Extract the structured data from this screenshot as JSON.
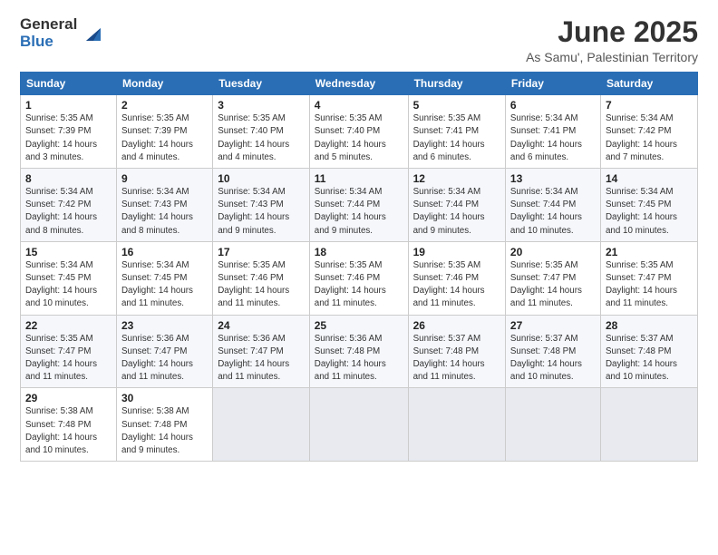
{
  "logo": {
    "general": "General",
    "blue": "Blue"
  },
  "title": "June 2025",
  "subtitle": "As Samu', Palestinian Territory",
  "days_of_week": [
    "Sunday",
    "Monday",
    "Tuesday",
    "Wednesday",
    "Thursday",
    "Friday",
    "Saturday"
  ],
  "weeks": [
    [
      {
        "day": "1",
        "sunrise": "5:35 AM",
        "sunset": "7:39 PM",
        "daylight": "14 hours and 3 minutes."
      },
      {
        "day": "2",
        "sunrise": "5:35 AM",
        "sunset": "7:39 PM",
        "daylight": "14 hours and 4 minutes."
      },
      {
        "day": "3",
        "sunrise": "5:35 AM",
        "sunset": "7:40 PM",
        "daylight": "14 hours and 4 minutes."
      },
      {
        "day": "4",
        "sunrise": "5:35 AM",
        "sunset": "7:40 PM",
        "daylight": "14 hours and 5 minutes."
      },
      {
        "day": "5",
        "sunrise": "5:35 AM",
        "sunset": "7:41 PM",
        "daylight": "14 hours and 6 minutes."
      },
      {
        "day": "6",
        "sunrise": "5:34 AM",
        "sunset": "7:41 PM",
        "daylight": "14 hours and 6 minutes."
      },
      {
        "day": "7",
        "sunrise": "5:34 AM",
        "sunset": "7:42 PM",
        "daylight": "14 hours and 7 minutes."
      }
    ],
    [
      {
        "day": "8",
        "sunrise": "5:34 AM",
        "sunset": "7:42 PM",
        "daylight": "14 hours and 8 minutes."
      },
      {
        "day": "9",
        "sunrise": "5:34 AM",
        "sunset": "7:43 PM",
        "daylight": "14 hours and 8 minutes."
      },
      {
        "day": "10",
        "sunrise": "5:34 AM",
        "sunset": "7:43 PM",
        "daylight": "14 hours and 9 minutes."
      },
      {
        "day": "11",
        "sunrise": "5:34 AM",
        "sunset": "7:44 PM",
        "daylight": "14 hours and 9 minutes."
      },
      {
        "day": "12",
        "sunrise": "5:34 AM",
        "sunset": "7:44 PM",
        "daylight": "14 hours and 9 minutes."
      },
      {
        "day": "13",
        "sunrise": "5:34 AM",
        "sunset": "7:44 PM",
        "daylight": "14 hours and 10 minutes."
      },
      {
        "day": "14",
        "sunrise": "5:34 AM",
        "sunset": "7:45 PM",
        "daylight": "14 hours and 10 minutes."
      }
    ],
    [
      {
        "day": "15",
        "sunrise": "5:34 AM",
        "sunset": "7:45 PM",
        "daylight": "14 hours and 10 minutes."
      },
      {
        "day": "16",
        "sunrise": "5:34 AM",
        "sunset": "7:45 PM",
        "daylight": "14 hours and 11 minutes."
      },
      {
        "day": "17",
        "sunrise": "5:35 AM",
        "sunset": "7:46 PM",
        "daylight": "14 hours and 11 minutes."
      },
      {
        "day": "18",
        "sunrise": "5:35 AM",
        "sunset": "7:46 PM",
        "daylight": "14 hours and 11 minutes."
      },
      {
        "day": "19",
        "sunrise": "5:35 AM",
        "sunset": "7:46 PM",
        "daylight": "14 hours and 11 minutes."
      },
      {
        "day": "20",
        "sunrise": "5:35 AM",
        "sunset": "7:47 PM",
        "daylight": "14 hours and 11 minutes."
      },
      {
        "day": "21",
        "sunrise": "5:35 AM",
        "sunset": "7:47 PM",
        "daylight": "14 hours and 11 minutes."
      }
    ],
    [
      {
        "day": "22",
        "sunrise": "5:35 AM",
        "sunset": "7:47 PM",
        "daylight": "14 hours and 11 minutes."
      },
      {
        "day": "23",
        "sunrise": "5:36 AM",
        "sunset": "7:47 PM",
        "daylight": "14 hours and 11 minutes."
      },
      {
        "day": "24",
        "sunrise": "5:36 AM",
        "sunset": "7:47 PM",
        "daylight": "14 hours and 11 minutes."
      },
      {
        "day": "25",
        "sunrise": "5:36 AM",
        "sunset": "7:48 PM",
        "daylight": "14 hours and 11 minutes."
      },
      {
        "day": "26",
        "sunrise": "5:37 AM",
        "sunset": "7:48 PM",
        "daylight": "14 hours and 11 minutes."
      },
      {
        "day": "27",
        "sunrise": "5:37 AM",
        "sunset": "7:48 PM",
        "daylight": "14 hours and 10 minutes."
      },
      {
        "day": "28",
        "sunrise": "5:37 AM",
        "sunset": "7:48 PM",
        "daylight": "14 hours and 10 minutes."
      }
    ],
    [
      {
        "day": "29",
        "sunrise": "5:38 AM",
        "sunset": "7:48 PM",
        "daylight": "14 hours and 10 minutes."
      },
      {
        "day": "30",
        "sunrise": "5:38 AM",
        "sunset": "7:48 PM",
        "daylight": "14 hours and 9 minutes."
      },
      null,
      null,
      null,
      null,
      null
    ]
  ]
}
